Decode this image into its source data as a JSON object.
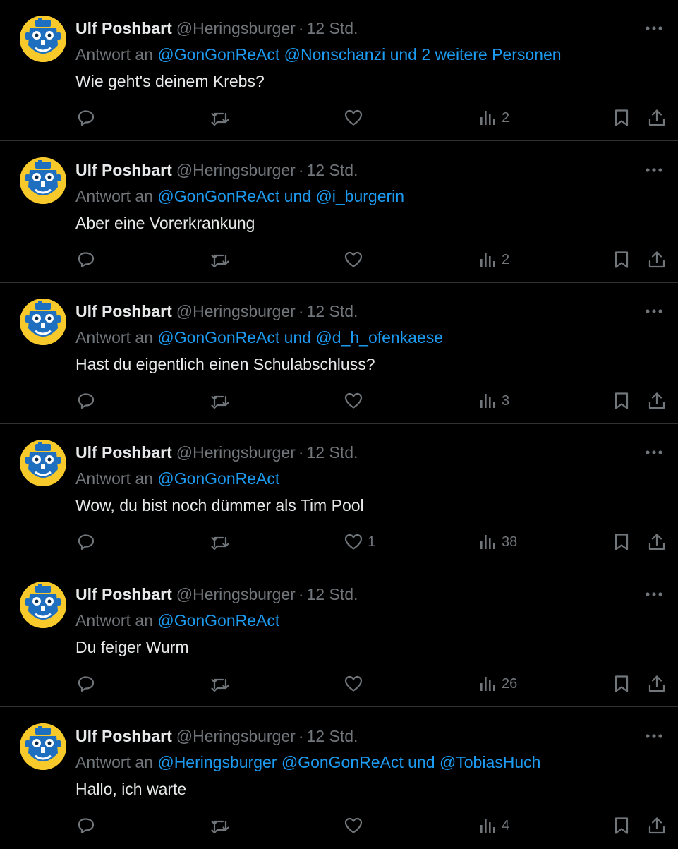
{
  "colors": {
    "background": "#000000",
    "text": "#e7e9ea",
    "muted": "#71767b",
    "link": "#1d9bf0",
    "divider": "#2f3336",
    "avatar_bg": "#f7c92a",
    "avatar_face": "#1f6fc1"
  },
  "icons": {
    "more": "more-dots-icon",
    "reply": "reply-icon",
    "retweet": "retweet-icon",
    "like": "heart-icon",
    "views": "views-bar-chart-icon",
    "bookmark": "bookmark-icon",
    "share": "share-icon"
  },
  "tweets": [
    {
      "name": "Ulf Poshbart",
      "handle": "@Heringsburger",
      "dot": "·",
      "time": "12 Std.",
      "reply_prefix": "Antwort an ",
      "mentions": [
        "@GonGonReAct",
        "@Nonschanzi"
      ],
      "reply_suffix": "und 2 weitere Personen",
      "text": "Wie geht's deinem Krebs?",
      "likes": "",
      "views": "2"
    },
    {
      "name": "Ulf Poshbart",
      "handle": "@Heringsburger",
      "dot": "·",
      "time": "12 Std.",
      "reply_prefix": "Antwort an ",
      "mentions": [
        "@GonGonReAct",
        "und",
        "@i_burgerin"
      ],
      "reply_suffix": "",
      "text": "Aber eine Vorerkrankung",
      "likes": "",
      "views": "2"
    },
    {
      "name": "Ulf Poshbart",
      "handle": "@Heringsburger",
      "dot": "·",
      "time": "12 Std.",
      "reply_prefix": "Antwort an ",
      "mentions": [
        "@GonGonReAct",
        "und",
        "@d_h_ofenkaese"
      ],
      "reply_suffix": "",
      "text": "Hast du eigentlich einen Schulabschluss?",
      "likes": "",
      "views": "3"
    },
    {
      "name": "Ulf Poshbart",
      "handle": "@Heringsburger",
      "dot": "·",
      "time": "12 Std.",
      "reply_prefix": "Antwort an ",
      "mentions": [
        "@GonGonReAct"
      ],
      "reply_suffix": "",
      "text": "Wow, du bist noch dümmer als Tim Pool",
      "likes": "1",
      "views": "38"
    },
    {
      "name": "Ulf Poshbart",
      "handle": "@Heringsburger",
      "dot": "·",
      "time": "12 Std.",
      "reply_prefix": "Antwort an ",
      "mentions": [
        "@GonGonReAct"
      ],
      "reply_suffix": "",
      "text": "Du feiger Wurm",
      "likes": "",
      "views": "26"
    },
    {
      "name": "Ulf Poshbart",
      "handle": "@Heringsburger",
      "dot": "·",
      "time": "12 Std.",
      "reply_prefix": "Antwort an ",
      "mentions": [
        "@Heringsburger",
        "@GonGonReAct",
        "und",
        "@TobiasHuch"
      ],
      "reply_suffix": "",
      "text": "Hallo, ich warte",
      "likes": "",
      "views": "4"
    }
  ]
}
